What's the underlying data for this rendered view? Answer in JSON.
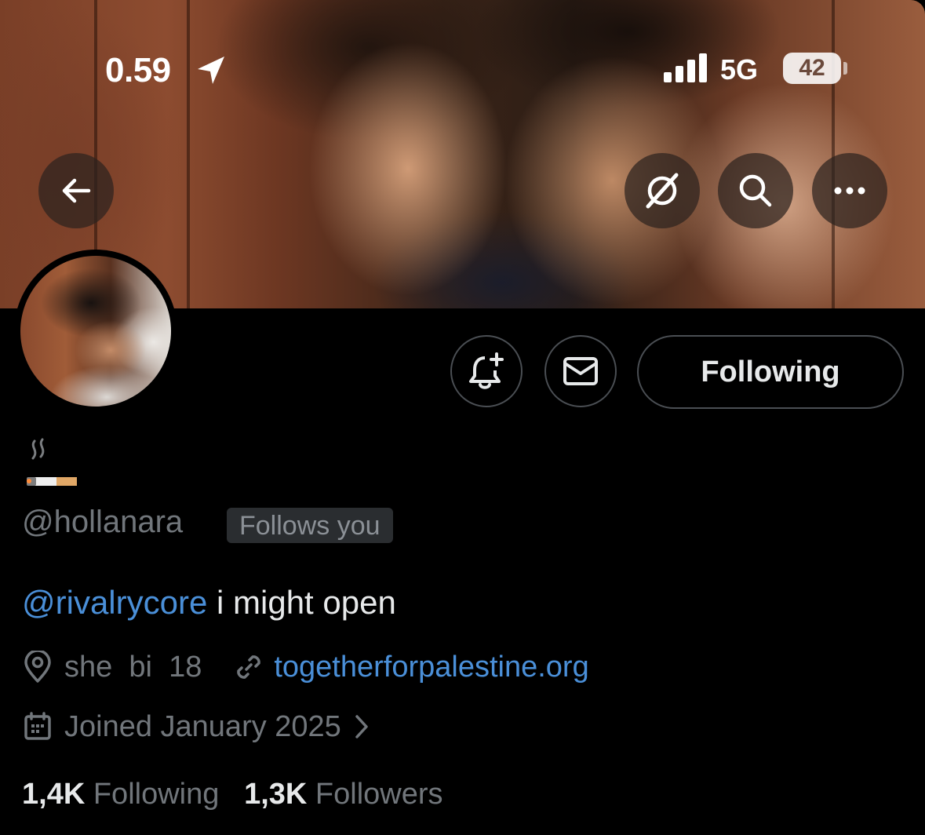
{
  "status_bar": {
    "time": "0.59",
    "network": "5G",
    "battery": "42"
  },
  "header": {
    "icons": {
      "back": "arrow-left-icon",
      "grok": "grok-icon",
      "search": "search-icon",
      "more": "more-icon"
    }
  },
  "profile": {
    "display_name_emoji": "cigarette-with-smoke",
    "handle": "@hollanara",
    "follows_you_badge": "Follows you",
    "bio_mention": "@rivalrycore",
    "bio_text": " i might open",
    "location": "she  bi  18",
    "website": "togetherforpalestine.org",
    "joined": "Joined January 2025",
    "following_count": "1,4K",
    "following_label": "Following",
    "followers_count": "1,3K",
    "followers_label": "Followers"
  },
  "actions": {
    "following_button": "Following",
    "notify_icon": "bell-plus-icon",
    "message_icon": "envelope-icon"
  },
  "colors": {
    "background": "#000000",
    "link": "#4a8fd8",
    "muted_text": "#71767b",
    "primary_text": "#e7e9ea",
    "border": "#4a4e53"
  }
}
